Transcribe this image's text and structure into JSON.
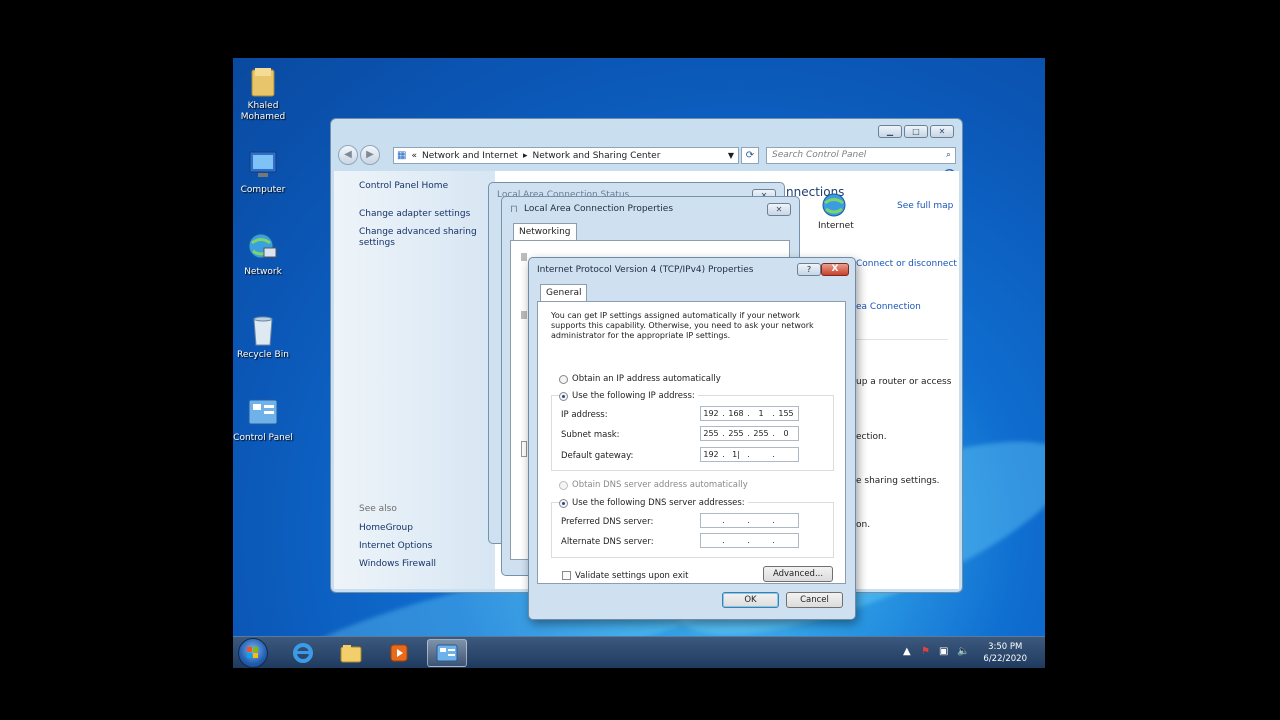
{
  "desktop": {
    "icons": [
      {
        "label": "Khaled Mohamed"
      },
      {
        "label": "Computer"
      },
      {
        "label": "Network"
      },
      {
        "label": "Recycle Bin"
      },
      {
        "label": "Control Panel"
      }
    ]
  },
  "control_panel": {
    "breadcrumb_prefix": "«",
    "breadcrumb": [
      "Network and Internet",
      "Network and Sharing Center"
    ],
    "search_placeholder": "Search Control Panel",
    "sidebar": {
      "home": "Control Panel Home",
      "links": [
        "Change adapter settings",
        "Change advanced sharing settings"
      ],
      "see_also_label": "See also",
      "see_also": [
        "HomeGroup",
        "Internet Options",
        "Windows Firewall"
      ]
    },
    "right": {
      "heading_fragment": "nnections",
      "see_full_map": "See full map",
      "internet_label": "Internet",
      "connect_disconnect": "Connect or disconnect",
      "area_connection": "ea Connection",
      "router_text": "up a router or access",
      "ection_text": "ection.",
      "sharing_text": "e sharing settings.",
      "on_text": "on."
    }
  },
  "status_dialog": {
    "title_fragment": "Local Area Connection Status"
  },
  "lac_dialog": {
    "title": "Local Area Connection Properties",
    "tab": "Networking"
  },
  "ipv4_dialog": {
    "title": "Internet Protocol Version 4 (TCP/IPv4) Properties",
    "help_glyph": "?",
    "close_glyph": "X",
    "tab": "General",
    "description": "You can get IP settings assigned automatically if your network supports this capability. Otherwise, you need to ask your network administrator for the appropriate IP settings.",
    "radio_auto_ip": "Obtain an IP address automatically",
    "radio_manual_ip": "Use the following IP address:",
    "ip_label": "IP address:",
    "ip_value": [
      "192",
      "168",
      "1",
      "155"
    ],
    "subnet_label": "Subnet mask:",
    "subnet_value": [
      "255",
      "255",
      "255",
      "0"
    ],
    "gateway_label": "Default gateway:",
    "gateway_value": [
      "192",
      "1|",
      "",
      ""
    ],
    "radio_auto_dns": "Obtain DNS server address automatically",
    "radio_manual_dns": "Use the following DNS server addresses:",
    "pref_dns_label": "Preferred DNS server:",
    "alt_dns_label": "Alternate DNS server:",
    "validate_label": "Validate settings upon exit",
    "advanced_button": "Advanced...",
    "ok_button": "OK",
    "cancel_button": "Cancel"
  },
  "taskbar": {
    "time": "3:50 PM",
    "date": "6/22/2020"
  }
}
